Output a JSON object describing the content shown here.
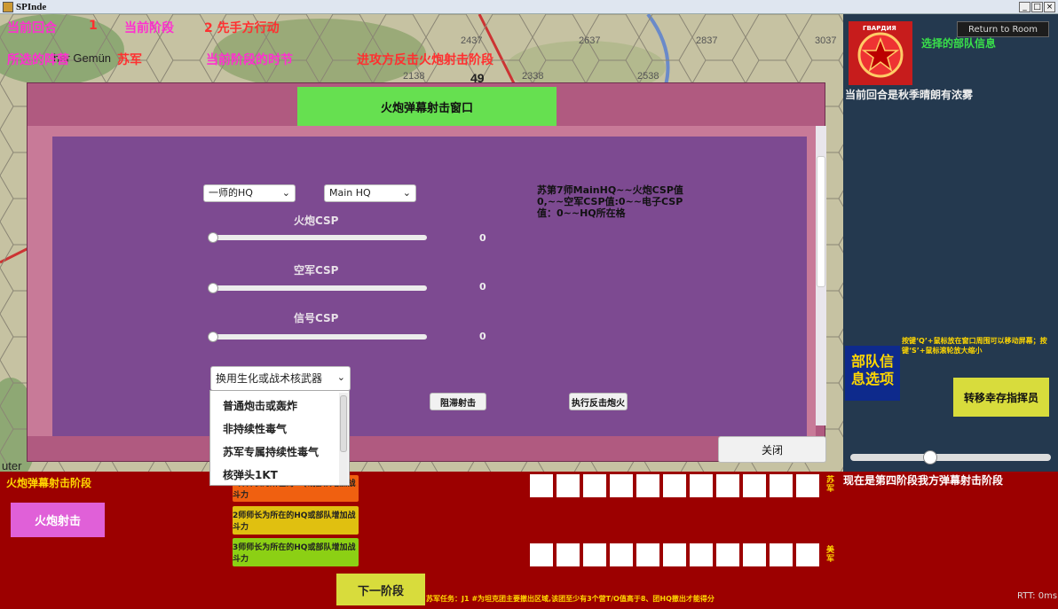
{
  "window": {
    "title": "SPInde",
    "min": "_",
    "max": "□",
    "close": "×"
  },
  "hud": {
    "round_label": "当前回合",
    "round_value": "1",
    "phase_label": "当前阶段",
    "phase_value": "2 先手方行动",
    "side_label": "所选的阵营",
    "side_value": "苏军",
    "segment_label": "当前阶段的时节",
    "segment_value": "进攻方反击火炮射击阶段"
  },
  "map": {
    "hexes": [
      "2437",
      "2637",
      "2837",
      "3037",
      "2138",
      "2338",
      "2538"
    ],
    "town": "her Gemün",
    "city2": "uter",
    "hexnum": "49"
  },
  "right": {
    "return_button": "Return to Room",
    "emblem_text": "ГВАРДИЯ",
    "unit_info_title": "选择的部队信息",
    "weather": "当前回合是秋季晴朗有浓雾",
    "help": "按键‘Q’+鼠标放在窗口周围可以移动屏幕；按键‘S’+鼠标滚轮放大缩小",
    "unit_options": "部队信息选项",
    "transfer_button": "转移幸存指挥员",
    "zoom_level": 0.4
  },
  "modal": {
    "title": "火炮弹幕射击窗口",
    "division_select": "一师的HQ",
    "hq_select": "Main HQ",
    "artillery_label": "火炮CSP",
    "artillery_value": "0",
    "air_label": "空军CSP",
    "air_value": "0",
    "signal_label": "信号CSP",
    "signal_value": "0",
    "info": "苏第7师MainHQ~~火炮CSP值0,~~空军CSP值:0~~电子CSP值：0~~HQ所在格",
    "weapon_select": "换用生化或战术核武器",
    "weapon_options": [
      "普通炮击或轰炸",
      "非持续性毒气",
      "苏军专属持续性毒气",
      "核弹头1KT"
    ],
    "delay_button": "阻滞射击",
    "counter_button": "执行反击炮火",
    "close_button": "关闭"
  },
  "bottom": {
    "phase_title": "火炮弹幕射击阶段",
    "fire_button": "火炮射击",
    "gen1": "1师师长为所在的HQ或部队增加战斗力",
    "gen2": "2师师长为所在的HQ或部队增加战斗力",
    "gen3": "3师师长为所在的HQ或部队增加战斗力",
    "next_button": "下一阶段",
    "soviet_label": "苏军",
    "us_label": "美军",
    "status": "现在是第四阶段我方弹幕射击阶段",
    "mission": "苏军任务：J1 #为坦克团主要撤出区域,该团至少有3个营T/O值高于8、团HQ撤出才能得分",
    "rtt": "RTT: 0ms"
  },
  "colors": {
    "modal_title_bg": "#66e050",
    "panel_purple": "#7d4a91",
    "bottom_bg": "#9c0000",
    "fire_btn": "#e060d8",
    "next_btn": "#d8dc3c"
  }
}
